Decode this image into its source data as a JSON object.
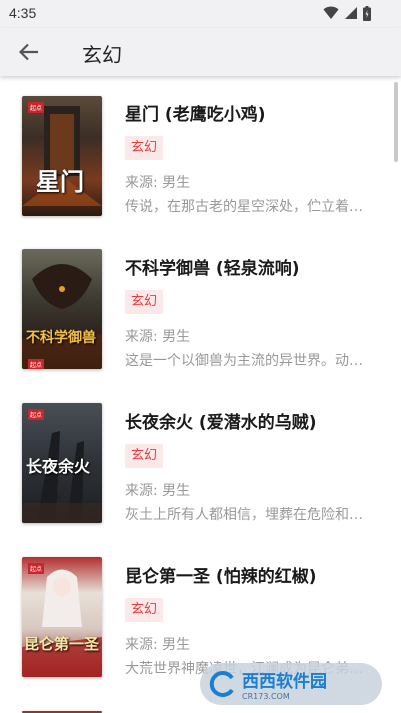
{
  "status": {
    "time": "4:35"
  },
  "header": {
    "title": "玄幻"
  },
  "books": [
    {
      "title": "星门 (老鹰吃小鸡)",
      "tag": "玄幻",
      "source": "来源: 男生",
      "desc": "传说，在那古老的星空深处，伫立着一道血与火侵染的红色之门……",
      "cover_text": "星门"
    },
    {
      "title": "不科学御兽 (轻泉流响)",
      "tag": "玄幻",
      "source": "来源: 男生",
      "desc": "这是一个以御兽为主流的异世界。动物和植物都可以成为御兽。",
      "cover_text": "不科学御兽"
    },
    {
      "title": "长夜余火 (爱潜水的乌贼)",
      "tag": "玄幻",
      "source": "来源: 男生",
      "desc": "灰土上所有人都相信，埋葬在危险和荒芜之中的旧世界宝藏……",
      "cover_text": "长夜余火"
    },
    {
      "title": "昆仑第一圣 (怕辣的红椒)",
      "tag": "玄幻",
      "source": "来源: 男生",
      "desc": "大荒世界神魔凌世，江澜成为昆仑弟子……",
      "cover_text": "昆仑第一圣"
    }
  ],
  "watermark": {
    "text": "西西软件园",
    "sub": "CR173.COM"
  }
}
